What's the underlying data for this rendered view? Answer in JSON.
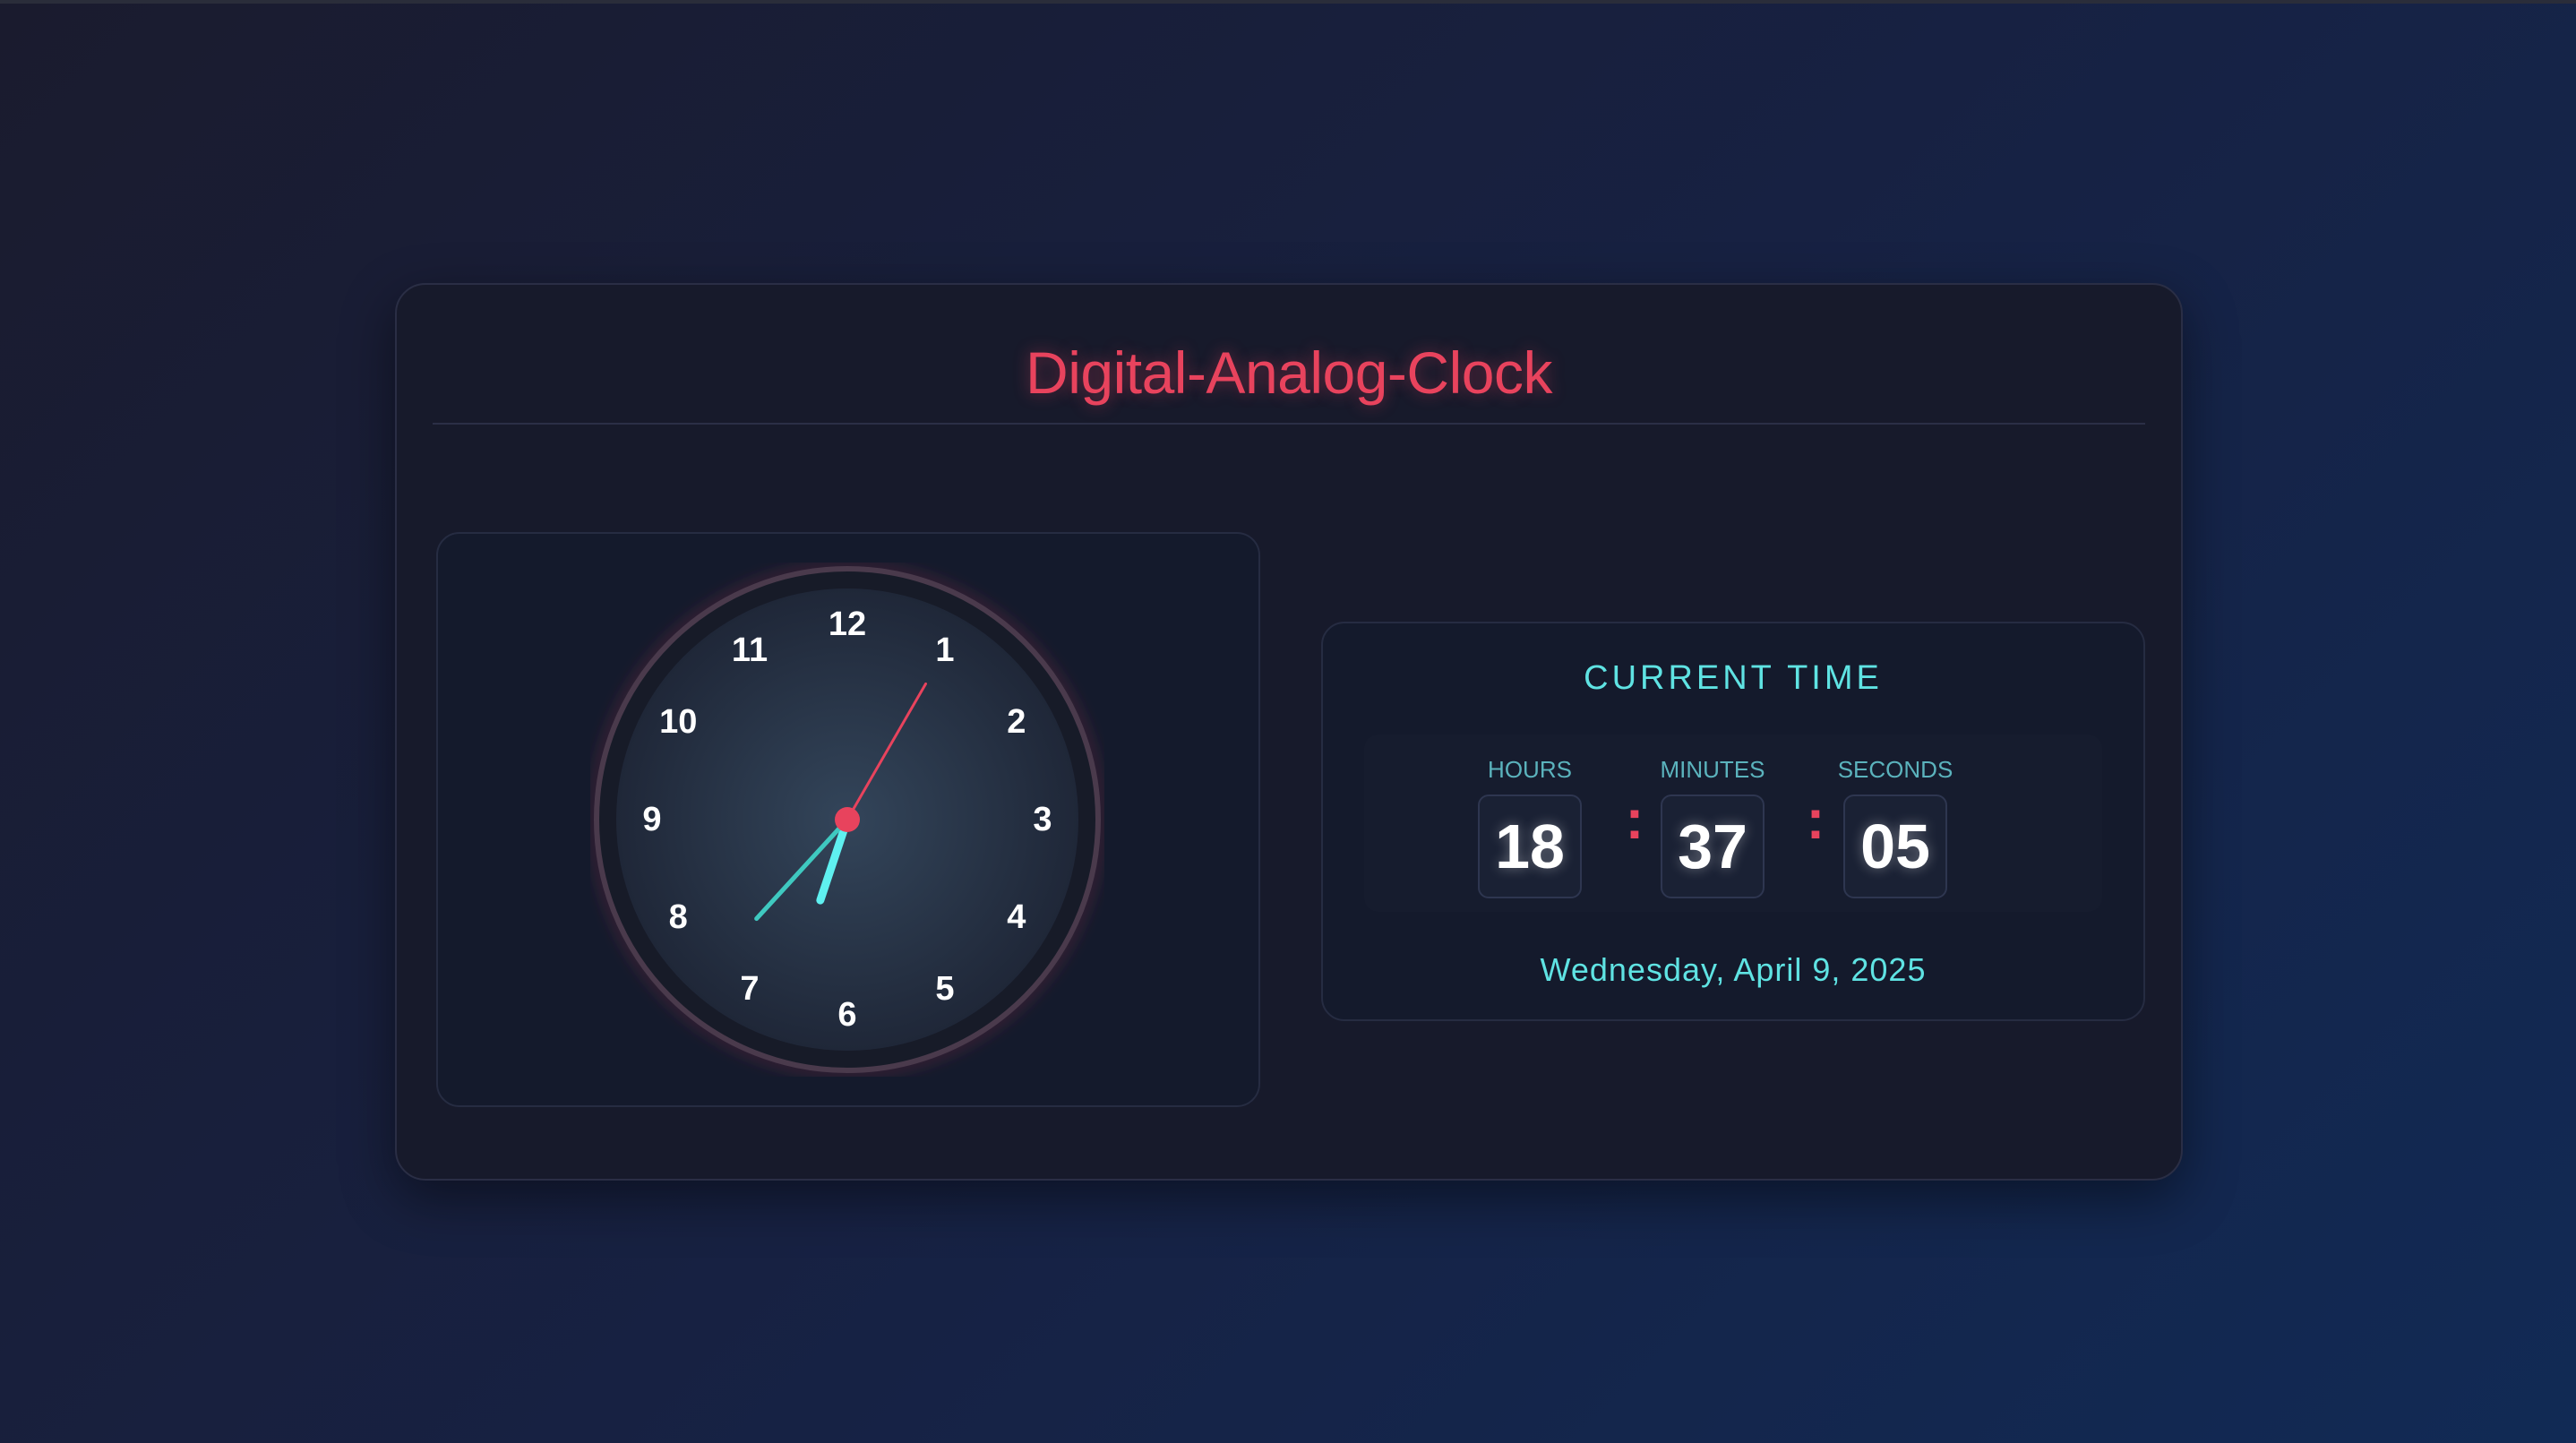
{
  "app": {
    "title": "Digital-Analog-Clock"
  },
  "analog": {
    "numerals": [
      "12",
      "1",
      "2",
      "3",
      "4",
      "5",
      "6",
      "7",
      "8",
      "9",
      "10",
      "11"
    ],
    "time": {
      "hours": 18,
      "minutes": 37,
      "seconds": 5
    }
  },
  "digital": {
    "heading": "CURRENT TIME",
    "hours_label": "HOURS",
    "minutes_label": "MINUTES",
    "seconds_label": "SECONDS",
    "hours": "18",
    "minutes": "37",
    "seconds": "05",
    "separator": ":",
    "date": "Wednesday, April 9, 2025"
  },
  "colors": {
    "accent_red": "#e8435d",
    "accent_cyan": "#5fe3e3",
    "minute_hand": "#3fc9c0",
    "background": "#171a2b"
  }
}
